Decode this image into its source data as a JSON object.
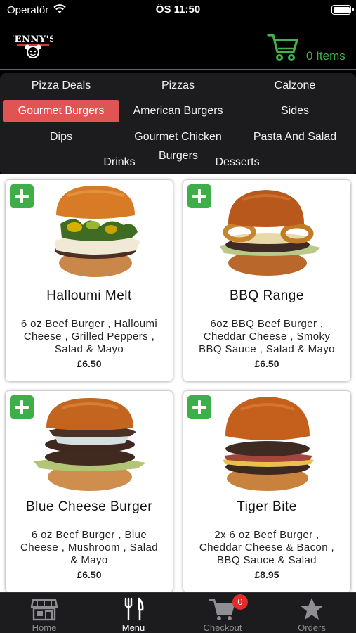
{
  "status_bar": {
    "carrier": "Operatör",
    "time": "ÖS 11:50"
  },
  "header": {
    "logo_text": "JENNY'S",
    "cart_label": "0 Items"
  },
  "categories": [
    {
      "label": "Pizza Deals"
    },
    {
      "label": "Pizzas"
    },
    {
      "label": "Calzone"
    },
    {
      "label": "Gourmet Burgers",
      "active": true
    },
    {
      "label": "American Burgers"
    },
    {
      "label": "Sides"
    },
    {
      "label": "Dips"
    },
    {
      "label": "Gourmet Chicken"
    },
    {
      "label": "Pasta And Salad"
    },
    {
      "label": "Drinks"
    },
    {
      "label": "Burgers"
    },
    {
      "label": "Desserts"
    }
  ],
  "products": [
    {
      "name": "Halloumi Melt",
      "description": "6 oz Beef Burger , Halloumi Cheese , Grilled Peppers , Salad & Mayo",
      "price": "£6.50"
    },
    {
      "name": "BBQ Range",
      "description": "6oz BBQ Beef Burger , Cheddar Cheese , Smoky BBQ Sauce , Salad & Mayo",
      "price": "£6.50"
    },
    {
      "name": "Blue Cheese Burger",
      "description": "6 oz Beef Burger , Blue Cheese , Mushroom , Salad & Mayo",
      "price": "£6.50"
    },
    {
      "name": "Tiger Bite",
      "description": "2x 6 oz Beef Burger , Cheddar Cheese & Bacon , BBQ Sauce & Salad",
      "price": "£8.95"
    }
  ],
  "tabs": [
    {
      "label": "Home",
      "icon": "store-icon"
    },
    {
      "label": "Menu",
      "icon": "fork-knife-icon",
      "active": true
    },
    {
      "label": "Checkout",
      "icon": "cart-icon",
      "badge": "0"
    },
    {
      "label": "Orders",
      "icon": "star-icon"
    }
  ],
  "colors": {
    "accent_green": "#3fb34a",
    "active_category": "#e05454",
    "badge_red": "#e52a2a"
  }
}
